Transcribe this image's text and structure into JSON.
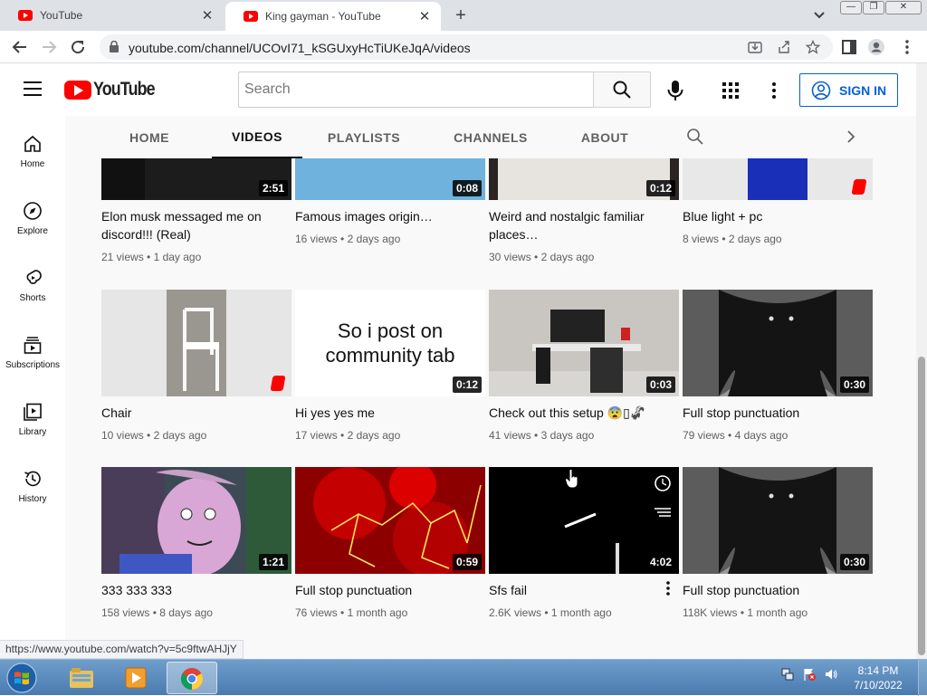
{
  "browser": {
    "tabs": [
      {
        "title": "YouTube",
        "active": false
      },
      {
        "title": "King gayman - YouTube",
        "active": true
      }
    ],
    "url": "youtube.com/channel/UCOvI71_kSGUxyHcTiUKeJqA/videos",
    "status_url": "https://www.youtube.com/watch?v=5c9ftwAHJjY",
    "win_controls": {
      "minimize": "—",
      "restore": "❐",
      "close": "✕"
    },
    "new_tab_glyph": "+"
  },
  "youtube": {
    "logo_text": "YouTube",
    "search_placeholder": "Search",
    "signin_label": "SIGN IN",
    "left_nav": [
      {
        "label": "Home",
        "icon": "home-icon"
      },
      {
        "label": "Explore",
        "icon": "compass-icon"
      },
      {
        "label": "Shorts",
        "icon": "shorts-icon"
      },
      {
        "label": "Subscriptions",
        "icon": "subscriptions-icon"
      },
      {
        "label": "Library",
        "icon": "library-icon"
      },
      {
        "label": "History",
        "icon": "history-icon"
      }
    ],
    "channel_tabs": [
      {
        "label": "HOME",
        "selected": false
      },
      {
        "label": "VIDEOS",
        "selected": true
      },
      {
        "label": "PLAYLISTS",
        "selected": false
      },
      {
        "label": "CHANNELS",
        "selected": false
      },
      {
        "label": "ABOUT",
        "selected": false
      }
    ],
    "videos": [
      {
        "title": "Elon musk messaged me on discord!!! (Real)",
        "views": "21 views",
        "age": "1 day ago",
        "duration": "2:51",
        "shorts": false,
        "thumb": "keyboard"
      },
      {
        "title": "Famous images origin…",
        "views": "16 views",
        "age": "2 days ago",
        "duration": "0:08",
        "shorts": false,
        "thumb": "water"
      },
      {
        "title": "Weird and nostalgic familiar places…",
        "views": "30 views",
        "age": "2 days ago",
        "duration": "0:12",
        "shorts": false,
        "thumb": "shelves"
      },
      {
        "title": "Blue light + pc",
        "views": "8 views",
        "age": "2 days ago",
        "duration": "",
        "shorts": true,
        "thumb": "bluelight"
      },
      {
        "title": "Chair",
        "views": "10 views",
        "age": "2 days ago",
        "duration": "",
        "shorts": true,
        "thumb": "chair"
      },
      {
        "title": "Hi yes yes me",
        "views": "17 views",
        "age": "2 days ago",
        "duration": "0:12",
        "shorts": false,
        "thumb": "text",
        "thumb_text": "So i post on community tab"
      },
      {
        "title": "Check out this setup 😨▯🦨",
        "views": "41 views",
        "age": "3 days ago",
        "duration": "0:03",
        "shorts": false,
        "thumb": "setup"
      },
      {
        "title": "Full stop punctuation",
        "views": "79 views",
        "age": "4 days ago",
        "duration": "0:30",
        "shorts": false,
        "thumb": "dark"
      },
      {
        "title": "333 333 333",
        "views": "158 views",
        "age": "8 days ago",
        "duration": "1:21",
        "shorts": false,
        "thumb": "face"
      },
      {
        "title": "Full stop punctuation",
        "views": "76 views",
        "age": "1 month ago",
        "duration": "0:59",
        "shorts": false,
        "thumb": "red"
      },
      {
        "title": "Sfs fail",
        "views": "2.6K views",
        "age": "1 month ago",
        "duration": "4:02",
        "shorts": false,
        "thumb": "space",
        "hovered": true
      },
      {
        "title": "Full stop punctuation",
        "views": "118K views",
        "age": "1 month ago",
        "duration": "0:30",
        "shorts": false,
        "thumb": "dark"
      }
    ]
  },
  "taskbar": {
    "clock_time": "8:14 PM",
    "clock_date": "7/10/2022",
    "items": [
      "explorer-icon",
      "media-player-icon",
      "chrome-icon"
    ]
  },
  "colors": {
    "yt_red": "#ff0000",
    "signin_blue": "#065fd4",
    "main_bg": "#f9f9f9",
    "taskbar": "#4a7bb0"
  }
}
